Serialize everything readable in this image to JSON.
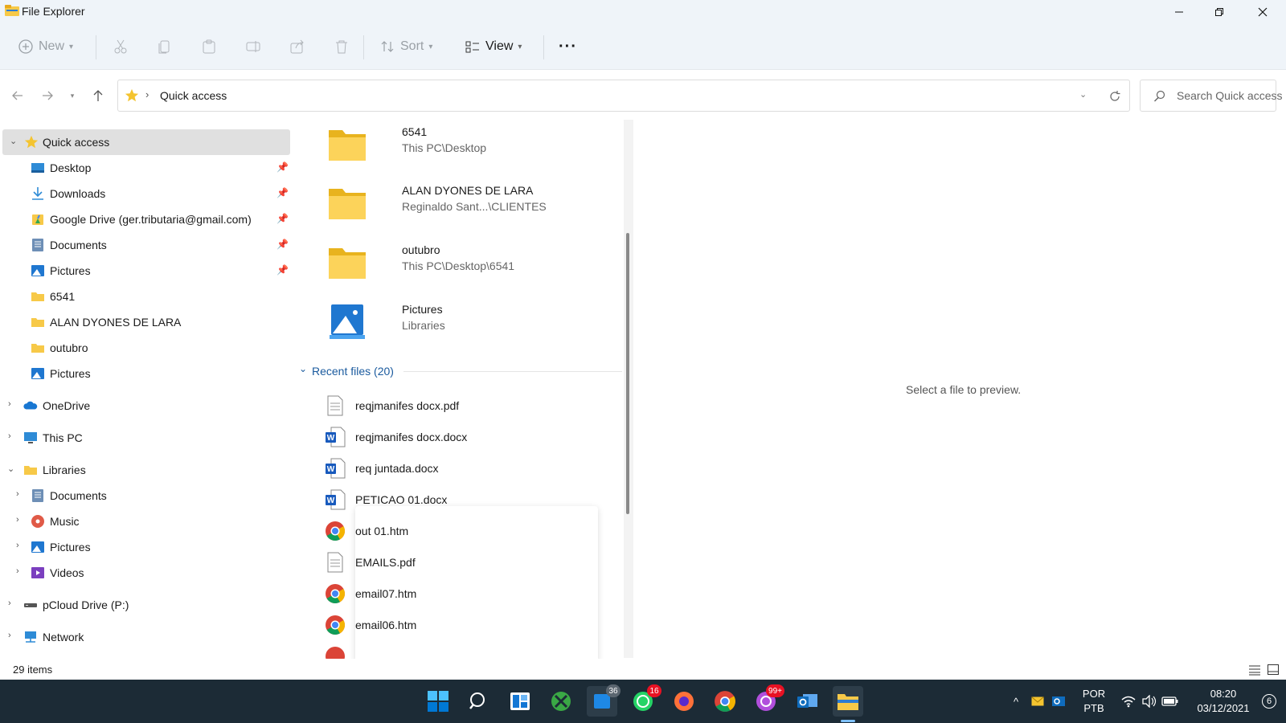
{
  "window": {
    "title": "File Explorer"
  },
  "toolbar": {
    "new_label": "New",
    "sort_label": "Sort",
    "view_label": "View",
    "more_label": "···"
  },
  "address": {
    "crumb": "Quick access",
    "search_placeholder": "Search Quick access"
  },
  "nav": {
    "quick_access": "Quick access",
    "pinned": [
      {
        "label": "Desktop",
        "icon": "desktop-icon"
      },
      {
        "label": "Downloads",
        "icon": "download-icon"
      },
      {
        "label": "Google Drive (ger.tributaria@gmail.com)",
        "icon": "google-drive-icon"
      },
      {
        "label": "Documents",
        "icon": "documents-icon"
      },
      {
        "label": "Pictures",
        "icon": "pictures-icon"
      }
    ],
    "recent_folders": [
      {
        "label": "6541",
        "icon": "folder-icon"
      },
      {
        "label": "ALAN DYONES DE LARA",
        "icon": "folder-icon"
      },
      {
        "label": "outubro",
        "icon": "folder-icon"
      },
      {
        "label": "Pictures",
        "icon": "pictures-icon"
      }
    ],
    "onedrive": "OneDrive",
    "this_pc": "This PC",
    "libraries": "Libraries",
    "library_items": [
      {
        "label": "Documents",
        "icon": "documents-icon"
      },
      {
        "label": "Music",
        "icon": "music-icon"
      },
      {
        "label": "Pictures",
        "icon": "pictures-icon"
      },
      {
        "label": "Videos",
        "icon": "videos-icon"
      }
    ],
    "pcloud": "pCloud Drive (P:)",
    "network": "Network"
  },
  "content": {
    "quick_items": [
      {
        "name": "6541",
        "path": "This PC\\Desktop",
        "icon": "folder-icon"
      },
      {
        "name": "ALAN DYONES DE LARA",
        "path": "Reginaldo Sant...\\CLIENTES",
        "icon": "folder-icon"
      },
      {
        "name": "outubro",
        "path": "This PC\\Desktop\\6541",
        "icon": "folder-icon"
      },
      {
        "name": "Pictures",
        "path": "Libraries",
        "icon": "pictures-icon"
      }
    ],
    "recent_header": "Recent files (20)",
    "recent_files": [
      {
        "name": "reqjmanifes docx.pdf",
        "icon": "pdf-icon"
      },
      {
        "name": "reqjmanifes docx.docx",
        "icon": "word-icon"
      },
      {
        "name": "req juntada.docx",
        "icon": "word-icon"
      },
      {
        "name": "PETICAO 01.docx",
        "icon": "word-icon"
      },
      {
        "name": "out 01.htm",
        "icon": "chrome-icon"
      },
      {
        "name": "EMAILS.pdf",
        "icon": "pdf-icon"
      },
      {
        "name": "email07.htm",
        "icon": "chrome-icon"
      },
      {
        "name": "email06.htm",
        "icon": "chrome-icon"
      }
    ]
  },
  "preview": {
    "message": "Select a file to preview."
  },
  "status": {
    "items": "29 items"
  },
  "taskbar": {
    "badges": {
      "mail": "36",
      "whatsapp": "16",
      "app": "99+"
    },
    "lang": "POR",
    "layout": "PTB",
    "time": "08:20",
    "date": "03/12/2021",
    "notif_count": "6"
  },
  "colors": {
    "folder": "#f7c948",
    "accent": "#0067c0",
    "taskbar": "#1c2b36",
    "selection": "#e0e0e0"
  }
}
